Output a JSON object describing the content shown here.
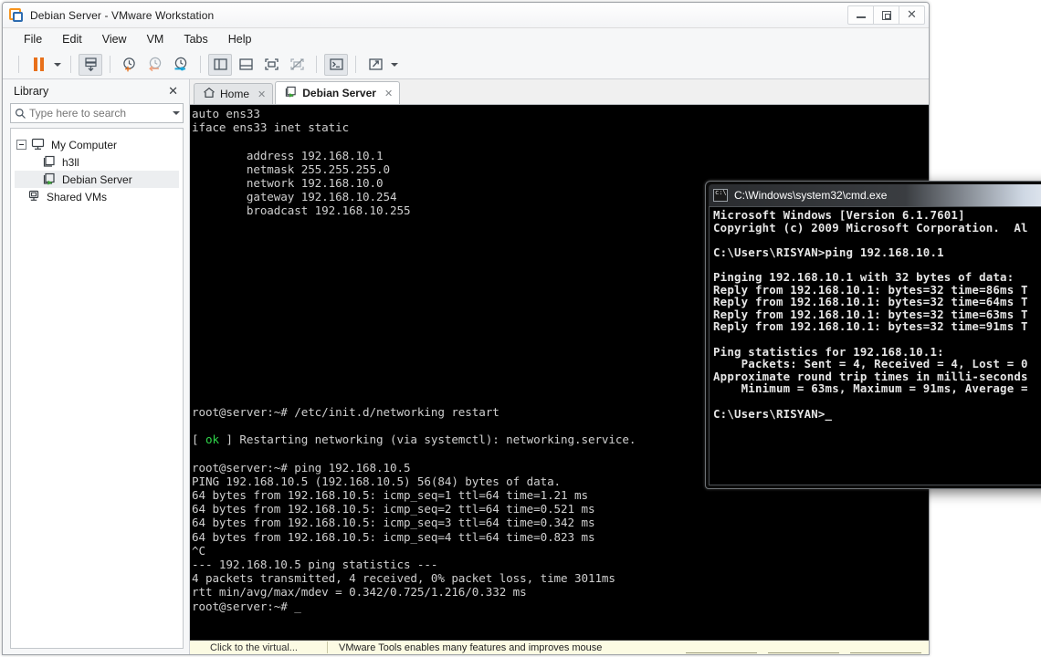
{
  "vmware": {
    "title": "Debian Server - VMware Workstation",
    "app_icon": "vmware-logo-icon",
    "window_controls": {
      "minimize": "minimize-button",
      "maximize": "maximize-button",
      "close": "close-button"
    },
    "menu": [
      {
        "label": "File"
      },
      {
        "label": "Edit"
      },
      {
        "label": "View"
      },
      {
        "label": "VM"
      },
      {
        "label": "Tabs"
      },
      {
        "label": "Help"
      }
    ],
    "toolbar": [
      {
        "name": "suspend-button",
        "icon": "pause-icon"
      },
      {
        "name": "suspend-dropdown",
        "icon": "chevron-down-icon"
      },
      {
        "name": "snapshot-button",
        "icon": "snapshot-icon"
      },
      {
        "name": "take-snapshot-button",
        "icon": "clock-plus-icon"
      },
      {
        "name": "revert-snapshot-button",
        "icon": "clock-back-icon"
      },
      {
        "name": "manage-snapshots-button",
        "icon": "clock-manage-icon"
      },
      {
        "name": "show-library-button",
        "icon": "sidebar-panel-icon"
      },
      {
        "name": "show-thumbnails-button",
        "icon": "bottom-panel-icon"
      },
      {
        "name": "show-console-view-button",
        "icon": "fit-screen-icon"
      },
      {
        "name": "hide-console-view-button",
        "icon": "fit-screen-off-icon"
      },
      {
        "name": "unity-mode-button",
        "icon": "terminal-prompt-icon"
      },
      {
        "name": "fullscreen-button",
        "icon": "expand-arrows-icon"
      },
      {
        "name": "fullscreen-dropdown",
        "icon": "chevron-down-icon"
      }
    ],
    "sidebar": {
      "title": "Library",
      "close_icon": "close-icon",
      "search": {
        "placeholder": "Type here to search",
        "value": "",
        "icon": "search-icon",
        "dropdown_icon": "chevron-down-icon"
      },
      "tree": [
        {
          "label": "My Computer",
          "icon": "computer-icon",
          "level": 0,
          "expanded": true,
          "selected": false
        },
        {
          "label": "h3ll",
          "icon": "vm-icon",
          "level": 1,
          "selected": false
        },
        {
          "label": "Debian Server",
          "icon": "vm-running-icon",
          "level": 1,
          "selected": true
        },
        {
          "label": "Shared VMs",
          "icon": "shared-vms-icon",
          "level": 0,
          "selected": false
        }
      ]
    },
    "tabs": [
      {
        "label": "Home",
        "icon": "home-icon",
        "active": false,
        "close_icon": "close-icon"
      },
      {
        "label": "Debian Server",
        "icon": "vm-running-icon",
        "active": true,
        "close_icon": "close-icon"
      }
    ],
    "notification": {
      "left_text": "Click to the virtual...",
      "text": "VMware Tools enables many features and improves mouse",
      "buttons": [
        "",
        "",
        ""
      ]
    }
  },
  "guest_terminal": {
    "top_output": "auto ens33\niface ens33 inet static\n\n        address 192.168.10.1\n        netmask 255.255.255.0\n        network 192.168.10.0\n        gateway 192.168.10.254\n        broadcast 192.168.10.255",
    "restart_cmd_line": "root@server:~# /etc/init.d/networking restart",
    "restart_status_prefix": "[ ",
    "restart_status_ok": "ok",
    "restart_status_suffix": " ] Restarting networking (via systemctl): networking.service.",
    "bottom_output": "root@server:~# ping 192.168.10.5\nPING 192.168.10.5 (192.168.10.5) 56(84) bytes of data.\n64 bytes from 192.168.10.5: icmp_seq=1 ttl=64 time=1.21 ms\n64 bytes from 192.168.10.5: icmp_seq=2 ttl=64 time=0.521 ms\n64 bytes from 192.168.10.5: icmp_seq=3 ttl=64 time=0.342 ms\n64 bytes from 192.168.10.5: icmp_seq=4 ttl=64 time=0.823 ms\n^C\n--- 192.168.10.5 ping statistics ---\n4 packets transmitted, 4 received, 0% packet loss, time 3011ms\nrtt min/avg/max/mdev = 0.342/0.725/1.216/0.332 ms\nroot@server:~# _"
  },
  "cmd": {
    "title": "C:\\Windows\\system32\\cmd.exe",
    "icon": "cmd-icon",
    "output": "Microsoft Windows [Version 6.1.7601]\nCopyright (c) 2009 Microsoft Corporation.  Al\n\nC:\\Users\\RISYAN>ping 192.168.10.1\n\nPinging 192.168.10.1 with 32 bytes of data:\nReply from 192.168.10.1: bytes=32 time=86ms T\nReply from 192.168.10.1: bytes=32 time=64ms T\nReply from 192.168.10.1: bytes=32 time=63ms T\nReply from 192.168.10.1: bytes=32 time=91ms T\n\nPing statistics for 192.168.10.1:\n    Packets: Sent = 4, Received = 4, Lost = 0\nApproximate round trip times in milli-seconds\n    Minimum = 63ms, Maximum = 91ms, Average =\n\nC:\\Users\\RISYAN>_"
  },
  "colors": {
    "accent_orange": "#e8701a",
    "terminal_bg": "#000000",
    "terminal_fg": "#cfcfcf",
    "ok_green": "#2fd64a",
    "notification_bg": "#fcfbe3"
  }
}
